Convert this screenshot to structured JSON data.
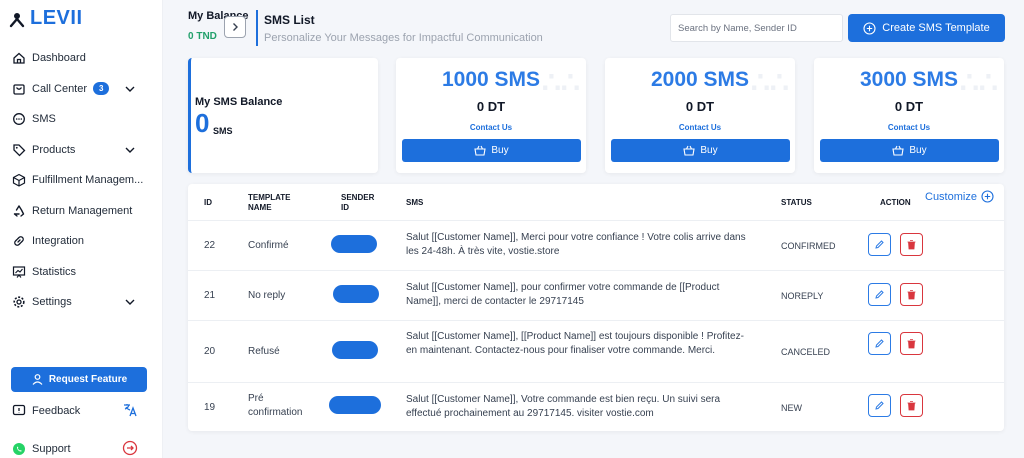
{
  "brand": {
    "name": "LEVII"
  },
  "sidebar": {
    "items": [
      {
        "label": "Dashboard",
        "icon": "home-icon"
      },
      {
        "label": "Call Center",
        "icon": "bag-icon",
        "badge": "3"
      },
      {
        "label": "SMS",
        "icon": "chat-icon"
      },
      {
        "label": "Products",
        "icon": "tag-icon"
      },
      {
        "label": "Fulfillment Managem...",
        "icon": "box-icon"
      },
      {
        "label": "Return Management",
        "icon": "recycle-icon"
      },
      {
        "label": "Integration",
        "icon": "link-icon"
      },
      {
        "label": "Statistics",
        "icon": "chart-icon"
      },
      {
        "label": "Settings",
        "icon": "gear-icon"
      }
    ],
    "request_feature": "Request Feature",
    "feedback": "Feedback",
    "support": "Support"
  },
  "header": {
    "balance_title": "My Balance",
    "balance_value": "0 TND",
    "title": "SMS List",
    "subtitle": "Personalize Your Messages for Impactful Communication",
    "search_placeholder": "Search by Name, Sender ID",
    "create_label": "Create SMS Template"
  },
  "balance_card": {
    "title": "My SMS Balance",
    "value": "0",
    "unit": "SMS"
  },
  "packages": [
    {
      "sms": "1000 SMS",
      "price": "0 DT",
      "contact": "Contact Us",
      "buy": "Buy"
    },
    {
      "sms": "2000 SMS",
      "price": "0 DT",
      "contact": "Contact Us",
      "buy": "Buy"
    },
    {
      "sms": "3000 SMS",
      "price": "0 DT",
      "contact": "Contact Us",
      "buy": "Buy"
    }
  ],
  "table": {
    "columns": [
      "ID",
      "TEMPLATE NAME",
      "SENDER ID",
      "SMS",
      "STATUS",
      "ACTION"
    ],
    "customize": "Customize",
    "rows": [
      {
        "id": "22",
        "name": "Confirmé",
        "sms": "Salut [[Customer Name]], Merci pour votre confiance ! Votre colis arrive dans les 24-48h. À très vite, vostie.store",
        "status": "CONFIRMED"
      },
      {
        "id": "21",
        "name": "No reply",
        "sms": "Salut [[Customer Name]], pour confirmer votre commande de [[Product Name]], merci de contacter le 29717145",
        "status": "NOREPLY"
      },
      {
        "id": "20",
        "name": "Refusé",
        "sms": "Salut [[Customer Name]], [[Product Name]] est toujours disponible ! Profitez-en maintenant. Contactez-nous pour finaliser votre commande. Merci.",
        "status": "CANCELED"
      },
      {
        "id": "19",
        "name": "Pré confirmation",
        "sms": "Salut [[Customer Name]], Votre commande est bien reçu. Un suivi sera effectué prochainement au 29717145. visiter vostie.com",
        "status": "NEW"
      }
    ]
  },
  "colors": {
    "accent": "#1d6fdc",
    "success": "#22a06b",
    "danger": "#d9363e"
  }
}
